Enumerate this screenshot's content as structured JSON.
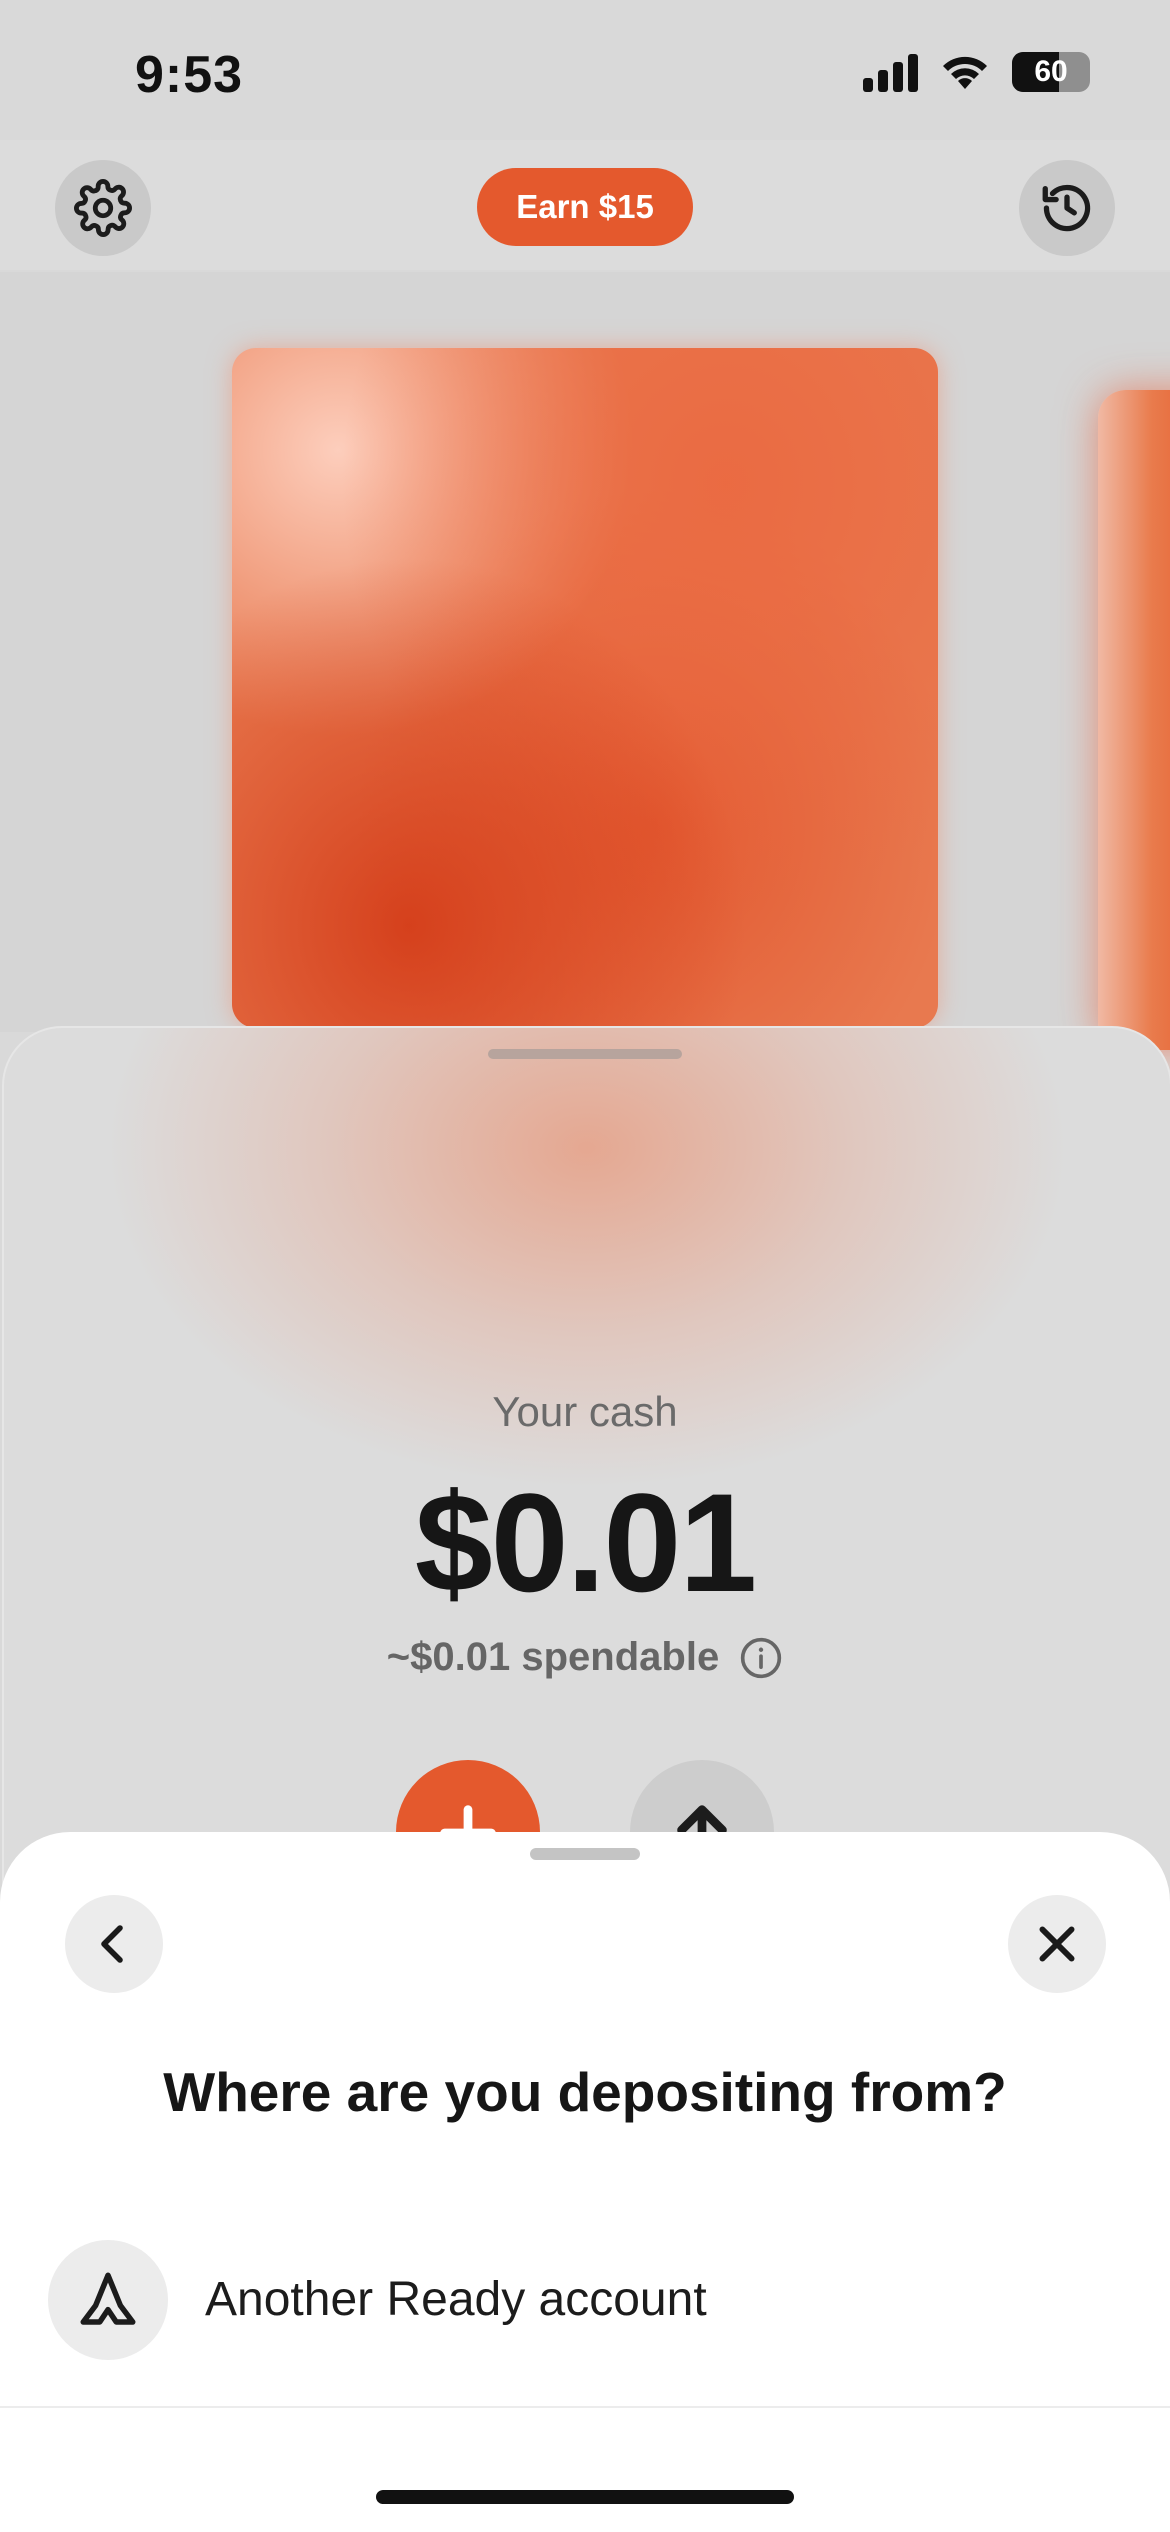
{
  "status_bar": {
    "time": "9:53",
    "battery_level": "60",
    "battery_fraction": 0.6,
    "icons": [
      "signal-icon",
      "wifi-icon",
      "battery-icon"
    ]
  },
  "header": {
    "settings_icon": "gear-icon",
    "earn_label": "Earn $15",
    "history_icon": "history-icon"
  },
  "colors": {
    "accent": "#e4592d",
    "text_primary": "#161616",
    "text_secondary": "#666666",
    "sheet_bg": "#ffffff"
  },
  "balance": {
    "label": "Your cash",
    "amount": "$0.01",
    "spendable": "~$0.01 spendable",
    "info_icon": "info-icon",
    "actions": [
      "plus-icon",
      "arrow-up-icon"
    ]
  },
  "deposit_sheet": {
    "back_icon": "chevron-left-icon",
    "close_icon": "close-icon",
    "title": "Where are you depositing from?",
    "options": [
      {
        "label": "Another Ready account",
        "icon": "ready-logo-icon"
      }
    ]
  }
}
